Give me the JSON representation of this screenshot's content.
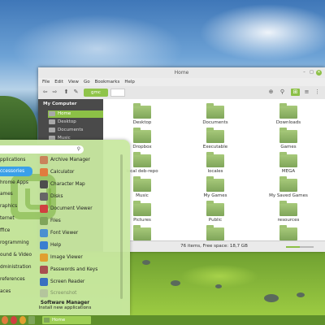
{
  "window": {
    "title": "Home",
    "menu": [
      "File",
      "Edit",
      "View",
      "Go",
      "Bookmarks",
      "Help"
    ],
    "breadcrumb": "gmc",
    "status": "76 items, Free space: 18,7 GB"
  },
  "sidebar": {
    "section": "My Computer",
    "items": [
      {
        "label": "Home",
        "selected": true
      },
      {
        "label": "Desktop",
        "selected": false
      },
      {
        "label": "Documents",
        "selected": false
      },
      {
        "label": "Music",
        "selected": false
      }
    ]
  },
  "files": [
    {
      "label": "Desktop",
      "icon": "desktop-folder-icon"
    },
    {
      "label": "Documents",
      "icon": "folder-icon"
    },
    {
      "label": "Downloads",
      "icon": "folder-icon"
    },
    {
      "label": "Dropbox",
      "icon": "folder-icon"
    },
    {
      "label": "Executable",
      "icon": "folder-icon"
    },
    {
      "label": "Games",
      "icon": "folder-icon"
    },
    {
      "label": "local deb-repo",
      "icon": "folder-icon"
    },
    {
      "label": "locales",
      "icon": "folder-icon"
    },
    {
      "label": "MEGA",
      "icon": "folder-icon"
    },
    {
      "label": "Music",
      "icon": "folder-icon"
    },
    {
      "label": "My Games",
      "icon": "folder-icon"
    },
    {
      "label": "My Saved Games",
      "icon": "folder-icon"
    },
    {
      "label": "Pictures",
      "icon": "folder-icon"
    },
    {
      "label": "Public",
      "icon": "folder-icon"
    },
    {
      "label": "resources",
      "icon": "folder-icon"
    },
    {
      "label": "",
      "icon": "folder-icon"
    },
    {
      "label": "",
      "icon": "folder-icon"
    },
    {
      "label": "",
      "icon": "folder-icon"
    }
  ],
  "menu": {
    "categories": [
      {
        "label": "pplications",
        "selected": false
      },
      {
        "label": "ccessories",
        "selected": true
      },
      {
        "label": "hrome Apps",
        "selected": false
      },
      {
        "label": "ames",
        "selected": false
      },
      {
        "label": "raphics",
        "selected": false
      },
      {
        "label": "ternet",
        "selected": false
      },
      {
        "label": "ffice",
        "selected": false
      },
      {
        "label": "rogramming",
        "selected": false
      },
      {
        "label": "ound & Video",
        "selected": false
      },
      {
        "label": "dministration",
        "selected": false
      },
      {
        "label": "references",
        "selected": false
      },
      {
        "label": "aces",
        "selected": false
      }
    ],
    "apps": [
      {
        "label": "Archive Manager",
        "color": "#c9835a"
      },
      {
        "label": "Calculator",
        "color": "#e07c3e"
      },
      {
        "label": "Character Map",
        "color": "#4d4d4d"
      },
      {
        "label": "Disks",
        "color": "#666666"
      },
      {
        "label": "Document Viewer",
        "color": "#d04040"
      },
      {
        "label": "Files",
        "color": "#7fa55a"
      },
      {
        "label": "Font Viewer",
        "color": "#4a8fd0"
      },
      {
        "label": "Help",
        "color": "#3a7fd0"
      },
      {
        "label": "Image Viewer",
        "color": "#e0a030"
      },
      {
        "label": "Passwords and Keys",
        "color": "#a85050"
      },
      {
        "label": "Screen Reader",
        "color": "#3a70c0"
      },
      {
        "label": "Screenshot",
        "color": "#a0a0a0"
      }
    ],
    "footer_title": "Software Manager",
    "footer_subtitle": "Install new applications"
  },
  "panel": {
    "task_label": "Home"
  },
  "colors": {
    "accent": "#8cc046",
    "selection_blue": "#3aa0e8"
  }
}
